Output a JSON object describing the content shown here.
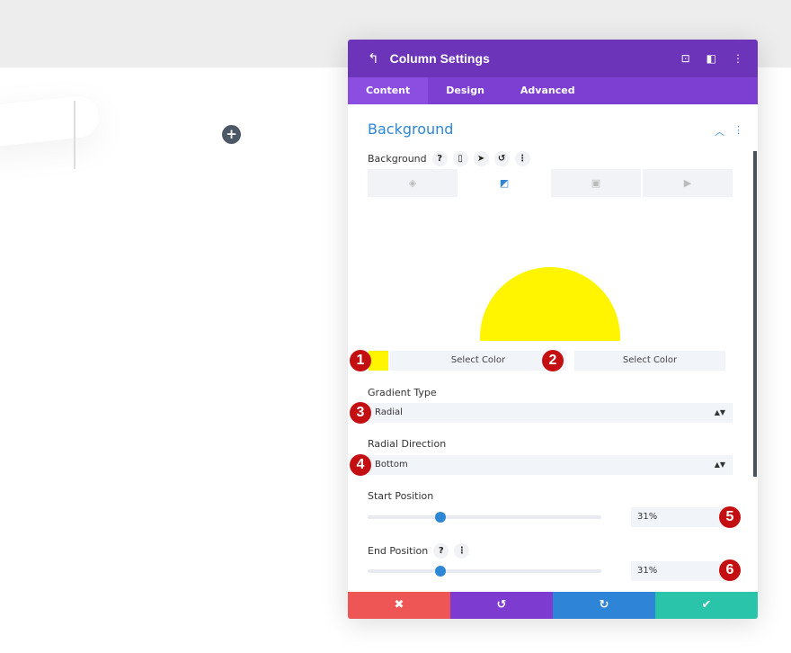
{
  "canvas": {
    "add_icon": "plus-icon"
  },
  "panel": {
    "title": "Column Settings",
    "tabs": [
      {
        "label": "Content",
        "active": true
      },
      {
        "label": "Design"
      },
      {
        "label": "Advanced"
      }
    ],
    "section_title": "Background",
    "background_label": "Background",
    "help": "?",
    "preview_color": "#fff500",
    "color1": {
      "swatch": "#fff500",
      "button": "Select Color"
    },
    "color2": {
      "button": "Select Color"
    },
    "gradient_type": {
      "label": "Gradient Type",
      "value": "Radial"
    },
    "radial_direction": {
      "label": "Radial Direction",
      "value": "Bottom"
    },
    "start_position": {
      "label": "Start Position",
      "value": "31%",
      "percent": 31
    },
    "end_position": {
      "label": "End Position",
      "value": "31%",
      "percent": 31
    },
    "badges": [
      "1",
      "2",
      "3",
      "4",
      "5",
      "6"
    ],
    "footer_colors": {
      "cancel": "#ee5655",
      "undo": "#7e3bd0",
      "redo": "#2e84d6",
      "save": "#29c4a9"
    }
  }
}
